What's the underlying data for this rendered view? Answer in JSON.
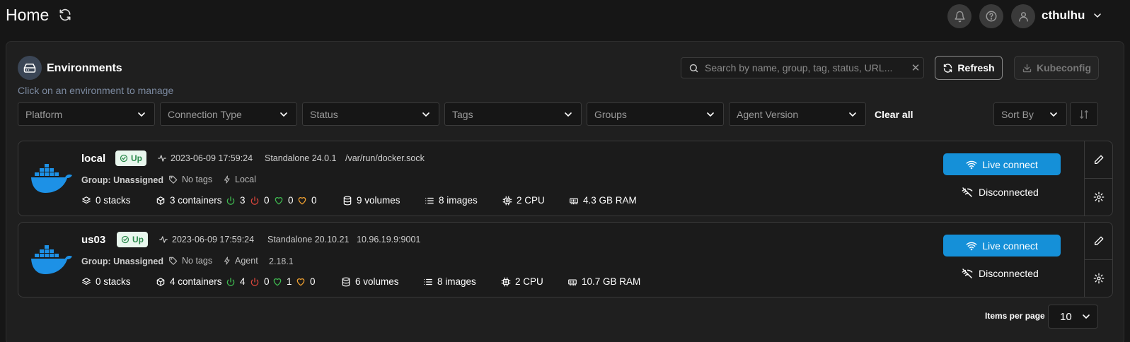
{
  "header": {
    "title": "Home",
    "user": "cthulhu"
  },
  "panel": {
    "title": "Environments",
    "subtitle": "Click on an environment to manage",
    "search_placeholder": "Search by name, group, tag, status, URL...",
    "refresh_label": "Refresh",
    "kubeconfig_label": "Kubeconfig",
    "filters": [
      "Platform",
      "Connection Type",
      "Status",
      "Tags",
      "Groups",
      "Agent Version"
    ],
    "clear_all": "Clear all",
    "sort_by": "Sort By"
  },
  "environments": [
    {
      "name": "local",
      "status": "Up",
      "timestamp": "2023-06-09 17:59:24",
      "type": "Standalone 24.0.1",
      "url": "/var/run/docker.sock",
      "group": "Group: Unassigned",
      "tags": "No tags",
      "connection": "Local",
      "agent_version": "",
      "stacks": "0 stacks",
      "containers": "3 containers",
      "running": "3",
      "stopped": "0",
      "healthy": "0",
      "unhealthy": "0",
      "volumes": "9 volumes",
      "images": "8 images",
      "cpu": "2 CPU",
      "ram": "4.3 GB RAM",
      "live_connect": "Live connect",
      "disconnected": "Disconnected"
    },
    {
      "name": "us03",
      "status": "Up",
      "timestamp": "2023-06-09 17:59:24",
      "type": "Standalone 20.10.21",
      "url": "10.96.19.9:9001",
      "group": "Group: Unassigned",
      "tags": "No tags",
      "connection": "Agent",
      "agent_version": "2.18.1",
      "stacks": "0 stacks",
      "containers": "4 containers",
      "running": "4",
      "stopped": "0",
      "healthy": "1",
      "unhealthy": "0",
      "volumes": "6 volumes",
      "images": "8 images",
      "cpu": "2 CPU",
      "ram": "10.7 GB RAM",
      "live_connect": "Live connect",
      "disconnected": "Disconnected"
    }
  ],
  "pagination": {
    "label": "Items per page",
    "value": "10"
  },
  "colors": {
    "background": "#161616",
    "panel": "#1f1f1f",
    "accent_blue": "#1590d8",
    "status_green": "#2c8a4d",
    "stopped_red": "#d9453b",
    "healthy_green": "#3fb950",
    "unhealthy_orange": "#f0a030"
  },
  "icons": {
    "refresh": "refresh-icon",
    "bell": "bell-icon",
    "help": "help-icon",
    "user": "user-icon",
    "environment": "hard-drive-icon",
    "docker": "docker-icon",
    "edit": "pencil-icon",
    "settings": "gear-icon",
    "wifi": "wifi-icon",
    "wifi_off": "wifi-off-icon"
  }
}
